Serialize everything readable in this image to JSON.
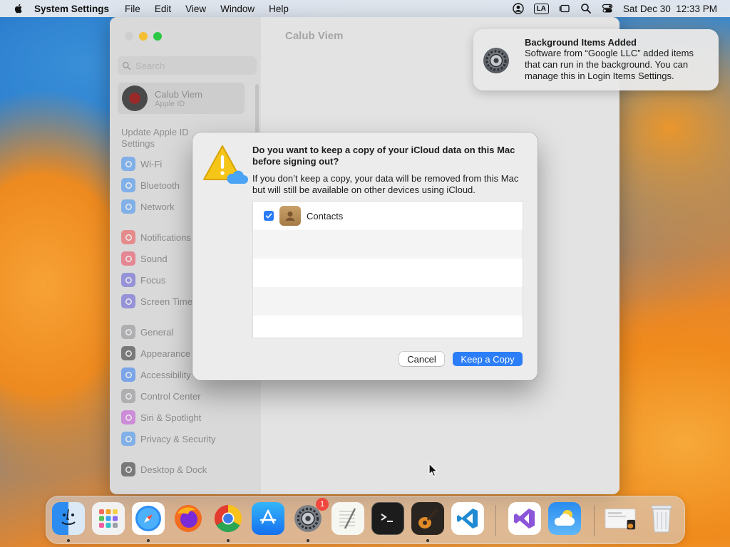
{
  "menubar": {
    "app_name": "System Settings",
    "menus": [
      "File",
      "Edit",
      "View",
      "Window",
      "Help"
    ],
    "input_source": "LA",
    "datetime": "Sat Dec 30  12:33 PM"
  },
  "settings": {
    "window_title": "Calub Viem",
    "search_placeholder": "Search",
    "account": {
      "name": "Calub Viem",
      "subtitle": "Apple ID"
    },
    "update_prompt": "Update Apple ID Settings",
    "sidebar_items": [
      {
        "label": "Wi-Fi",
        "icon": "wifi-icon",
        "color": "#3b8ff5"
      },
      {
        "label": "Bluetooth",
        "icon": "bluetooth-icon",
        "color": "#3b8ff5"
      },
      {
        "label": "Network",
        "icon": "globe-icon",
        "color": "#3b8ff5"
      },
      {
        "label": "Notifications",
        "icon": "bell-icon",
        "color": "#f04c4c"
      },
      {
        "label": "Sound",
        "icon": "speaker-icon",
        "color": "#f0445b"
      },
      {
        "label": "Focus",
        "icon": "moon-icon",
        "color": "#6059d6"
      },
      {
        "label": "Screen Time",
        "icon": "hourglass-icon",
        "color": "#6059d6"
      },
      {
        "label": "General",
        "icon": "gear-icon",
        "color": "#8e8e93"
      },
      {
        "label": "Appearance",
        "icon": "appearance-icon",
        "color": "#2c2c2e"
      },
      {
        "label": "Accessibility",
        "icon": "accessibility-icon",
        "color": "#2d7cf6"
      },
      {
        "label": "Control Center",
        "icon": "control-center-icon",
        "color": "#8e8e93"
      },
      {
        "label": "Siri & Spotlight",
        "icon": "siri-icon",
        "color": "#c54fd6"
      },
      {
        "label": "Privacy & Security",
        "icon": "hand-icon",
        "color": "#3b8ff5"
      },
      {
        "label": "Desktop & Dock",
        "icon": "dock-icon",
        "color": "#2c2c2e"
      }
    ]
  },
  "notification": {
    "title": "Background Items Added",
    "body": "Software from “Google LLC” added items that can run in the background. You can manage this in Login Items Settings.",
    "icon": "system-settings-gear-icon"
  },
  "dialog": {
    "title": "Do you want to keep a copy of your iCloud data on this Mac before signing out?",
    "message": "If you don’t keep a copy, your data will be removed from this Mac but will still be available on other devices using iCloud.",
    "items": [
      {
        "label": "Contacts",
        "checked": true,
        "icon": "contacts-icon"
      }
    ],
    "cancel_label": "Cancel",
    "confirm_label": "Keep a Copy"
  },
  "dock": {
    "apps": [
      {
        "name": "Finder",
        "icon": "finder-icon",
        "running": true
      },
      {
        "name": "Launchpad",
        "icon": "launchpad-icon",
        "running": false
      },
      {
        "name": "Safari",
        "icon": "safari-icon",
        "running": true
      },
      {
        "name": "Firefox",
        "icon": "firefox-icon",
        "running": false
      },
      {
        "name": "Google Chrome",
        "icon": "chrome-icon",
        "running": true
      },
      {
        "name": "App Store",
        "icon": "app-store-icon",
        "running": false
      },
      {
        "name": "System Settings",
        "icon": "system-settings-icon",
        "running": true,
        "badge": "1"
      },
      {
        "name": "TextEdit",
        "icon": "textedit-icon",
        "running": false
      },
      {
        "name": "Terminal",
        "icon": "terminal-icon",
        "running": false
      },
      {
        "name": "GarageBand",
        "icon": "garageband-icon",
        "running": true
      },
      {
        "name": "Visual Studio Code",
        "icon": "vscode-icon",
        "running": false
      },
      {
        "name": "Visual Studio",
        "icon": "visual-studio-icon",
        "running": false
      },
      {
        "name": "Weather",
        "icon": "weather-icon",
        "running": false
      },
      {
        "name": "Downloads",
        "icon": "downloads-stack-icon",
        "running": false
      },
      {
        "name": "Trash",
        "icon": "trash-icon",
        "running": false
      }
    ]
  }
}
